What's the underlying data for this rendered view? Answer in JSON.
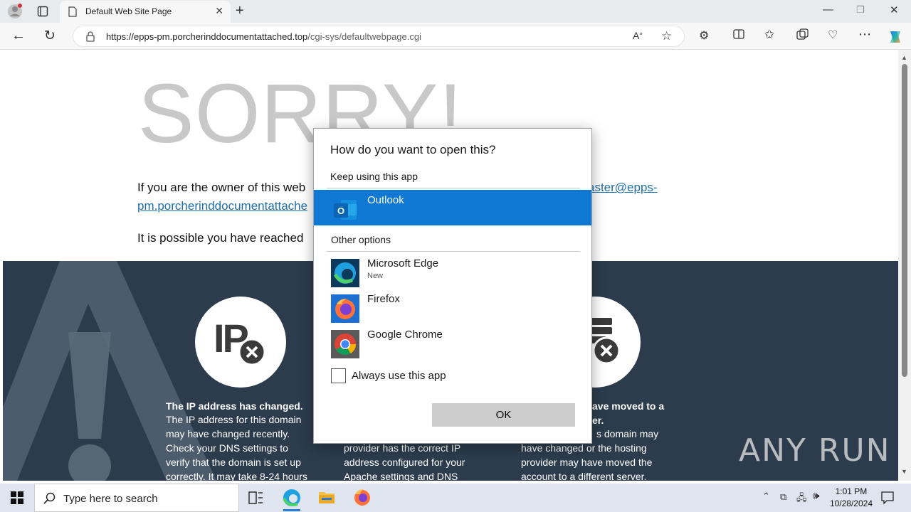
{
  "browser": {
    "tab_title": "Default Web Site Page",
    "url_domain": "https://epps-pm.porcherinddocumentattached.top",
    "url_path": "/cgi-sys/defaultwebpage.cgi"
  },
  "page": {
    "heading": "SORRY!",
    "para1_start": "If you are the owner of this web",
    "para1_link_right": "aster@epps-",
    "para1_link_left": "pm.porcherinddocumentattache",
    "para2_start": "It is possible you have reached",
    "card1_heading": "The IP address has changed.",
    "card1_lines": [
      "The IP address for this domain",
      "may have changed recently.",
      "Check your DNS settings to",
      "verify that the domain is set up",
      "correctly. It may take 8-24 hours"
    ],
    "card2_lines": [
      "provider has the correct IP",
      "address configured for your",
      "Apache settings and DNS"
    ],
    "card3_heading1": "ave moved to a",
    "card3_heading2": "er.",
    "card3_lines": [
      "s domain may",
      "have changed or the hosting",
      "provider may have moved the",
      "account to a different server."
    ],
    "ip_icon_text": "IP"
  },
  "dialog": {
    "title": "How do you want to open this?",
    "keep_section": "Keep using this app",
    "other_section": "Other options",
    "apps": [
      {
        "name": "Outlook",
        "sub": "",
        "selected": true
      },
      {
        "name": "Microsoft Edge",
        "sub": "New",
        "selected": false
      },
      {
        "name": "Firefox",
        "sub": "",
        "selected": false
      },
      {
        "name": "Google Chrome",
        "sub": "",
        "selected": false
      }
    ],
    "always_label": "Always use this app",
    "ok_label": "OK"
  },
  "taskbar": {
    "search_placeholder": "Type here to search",
    "time": "1:01 PM",
    "date": "10/28/2024"
  },
  "watermark": "ANY RUN"
}
